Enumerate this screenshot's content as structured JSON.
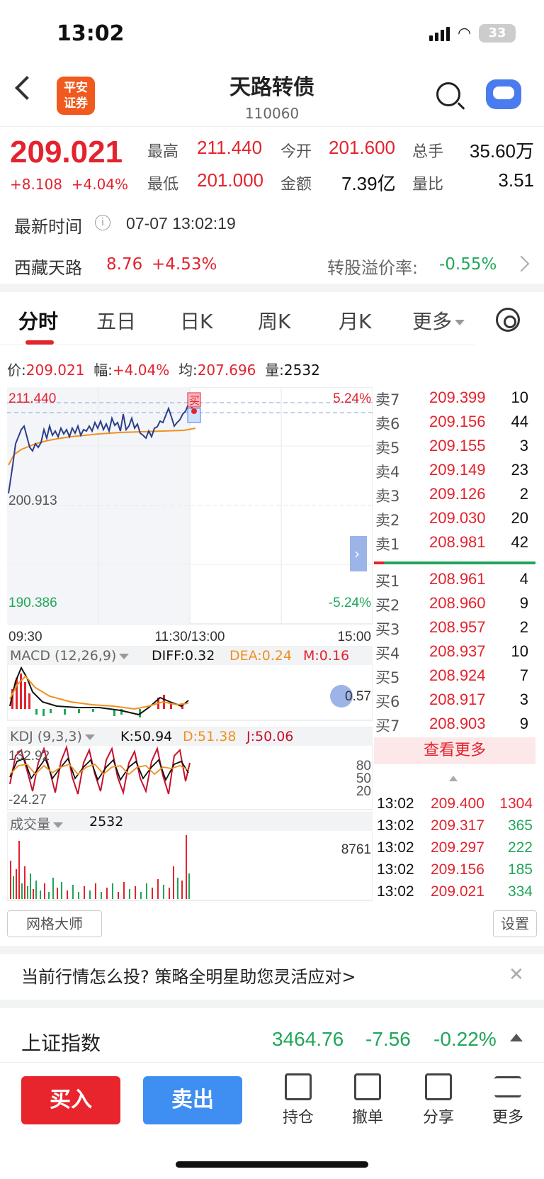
{
  "status": {
    "time": "13:02",
    "battery": "33"
  },
  "header": {
    "logo": "平安\n证券",
    "title": "天路转债",
    "code": "110060"
  },
  "quote": {
    "price": "209.021",
    "change": "+8.108  +4.04%",
    "high_label": "最高",
    "high": "211.440",
    "open_label": "今开",
    "open": "201.600",
    "hands_label": "总手",
    "hands": "35.60万",
    "low_label": "最低",
    "low": "201.000",
    "amount_label": "金额",
    "amount": "7.39亿",
    "ratio_label": "量比",
    "ratio": "3.51",
    "time_label": "最新时间",
    "time_value": "07-07 13:02:19"
  },
  "underlying": {
    "name": "西藏天路",
    "price": "8.76",
    "pct": "+4.53%",
    "premium_label": "转股溢价率:",
    "premium": "-0.55%"
  },
  "tabs": [
    "分时",
    "五日",
    "日K",
    "周K",
    "月K",
    "更多"
  ],
  "info_bar": {
    "price_label": "价:",
    "price": "209.021",
    "amp_label": "幅:",
    "amp": "+4.04%",
    "avg_label": "均:",
    "avg": "207.696",
    "vol_label": "量:",
    "vol": "2532"
  },
  "chart": {
    "y_top": "211.440",
    "y_mid": "200.913",
    "y_bot": "190.386",
    "pct_top": "5.24%",
    "pct_bot": "-5.24%",
    "x_start": "09:30",
    "x_mid": "11:30/13:00",
    "x_end": "15:00",
    "buy_mark": "买"
  },
  "macd": {
    "label": "MACD (12,26,9)",
    "diff": "DIFF:0.32",
    "dea": "DEA:0.24",
    "m": "M:0.16",
    "right_val": "0.57"
  },
  "kdj": {
    "label": "KDJ (9,3,3)",
    "k": "K:50.94",
    "d": "D:51.38",
    "j": "J:50.06",
    "top_val": "132.92",
    "bot_val": "-24.27",
    "lvl80": "80",
    "lvl50": "50",
    "lvl20": "20"
  },
  "volume": {
    "label": "成交量",
    "value": "2532",
    "max": "8761"
  },
  "order_book": {
    "asks": [
      {
        "label": "卖7",
        "price": "209.399",
        "vol": "10"
      },
      {
        "label": "卖6",
        "price": "209.156",
        "vol": "44"
      },
      {
        "label": "卖5",
        "price": "209.155",
        "vol": "3"
      },
      {
        "label": "卖4",
        "price": "209.149",
        "vol": "23"
      },
      {
        "label": "卖3",
        "price": "209.126",
        "vol": "2"
      },
      {
        "label": "卖2",
        "price": "209.030",
        "vol": "20"
      },
      {
        "label": "卖1",
        "price": "208.981",
        "vol": "42"
      }
    ],
    "bids": [
      {
        "label": "买1",
        "price": "208.961",
        "vol": "4"
      },
      {
        "label": "买2",
        "price": "208.960",
        "vol": "9"
      },
      {
        "label": "买3",
        "price": "208.957",
        "vol": "2"
      },
      {
        "label": "买4",
        "price": "208.937",
        "vol": "10"
      },
      {
        "label": "买5",
        "price": "208.924",
        "vol": "7"
      },
      {
        "label": "买6",
        "price": "208.917",
        "vol": "3"
      },
      {
        "label": "买7",
        "price": "208.903",
        "vol": "9"
      }
    ],
    "more": "查看更多"
  },
  "ticks": [
    {
      "time": "13:02",
      "price": "209.400",
      "vol": "1304",
      "vol_color": "#e3232e"
    },
    {
      "time": "13:02",
      "price": "209.317",
      "vol": "365",
      "vol_color": "#20a65a"
    },
    {
      "time": "13:02",
      "price": "209.297",
      "vol": "222",
      "vol_color": "#20a65a"
    },
    {
      "time": "13:02",
      "price": "209.156",
      "vol": "185",
      "vol_color": "#20a65a"
    },
    {
      "time": "13:02",
      "price": "209.021",
      "vol": "334",
      "vol_color": "#20a65a"
    }
  ],
  "tools": {
    "grid_master": "网格大师",
    "settings": "设置"
  },
  "promo": "当前行情怎么投? 策略全明星助您灵活应对>",
  "index": {
    "name": "上证指数",
    "value": "3464.76",
    "change": "-7.56",
    "pct": "-0.22%"
  },
  "bottom": {
    "buy": "买入",
    "sell": "卖出",
    "tools": [
      "持仓",
      "撤单",
      "分享",
      "更多"
    ]
  },
  "colors": {
    "up": "#e3232e",
    "down": "#20a65a",
    "buy_btn": "#e8242c",
    "sell_btn": "#3f8ef2"
  }
}
